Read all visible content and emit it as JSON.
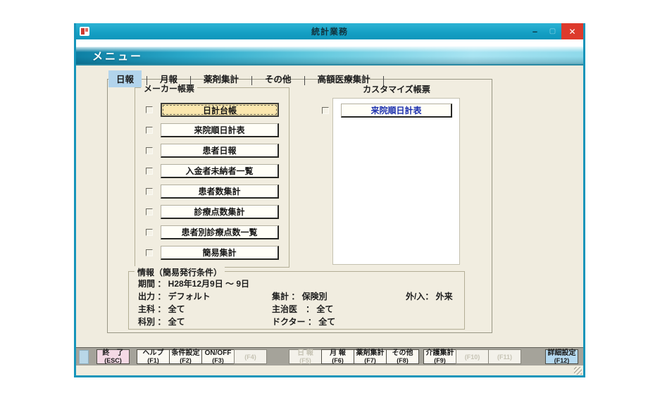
{
  "window": {
    "title": "統計業務",
    "controls": {
      "minimize": "–",
      "maximize": "▢",
      "close": "✕"
    }
  },
  "menu_header": "メニュー",
  "tabs": [
    {
      "label": "日報",
      "selected": true
    },
    {
      "label": "月報",
      "selected": false
    },
    {
      "label": "薬剤集計",
      "selected": false
    },
    {
      "label": "その他",
      "selected": false
    },
    {
      "label": "高額医療集計",
      "selected": false
    }
  ],
  "maker": {
    "title": "メーカー帳票",
    "items": [
      {
        "label": "日計台帳",
        "checked": false,
        "focused": true
      },
      {
        "label": "来院順日計表",
        "checked": false,
        "focused": false
      },
      {
        "label": "患者日報",
        "checked": false,
        "focused": false
      },
      {
        "label": "入金者未納者一覧",
        "checked": false,
        "focused": false
      },
      {
        "label": "患者数集計",
        "checked": false,
        "focused": false
      },
      {
        "label": "診療点数集計",
        "checked": false,
        "focused": false
      },
      {
        "label": "患者別診療点数一覧",
        "checked": false,
        "focused": false
      },
      {
        "label": "簡易集計",
        "checked": false,
        "focused": false
      }
    ]
  },
  "custom": {
    "title": "カスタマイズ帳票",
    "items": [
      {
        "label": "来院順日計表",
        "checked": false,
        "text_color": "#1b2fae"
      }
    ]
  },
  "info": {
    "title": "情報（簡易発行条件）",
    "period": {
      "label": "期間 ： ",
      "value": "H28年12月9日 ～ 9日"
    },
    "output": {
      "label": "出力 ： ",
      "value": "デフォルト"
    },
    "aggregate": {
      "label": "集計 ： ",
      "value": "保険別"
    },
    "inout": {
      "label": "外/入： ",
      "value": "外来"
    },
    "main_dept": {
      "label": "主科 ： ",
      "value": "全て"
    },
    "main_doctor": {
      "label": "主治医　： ",
      "value": "全て"
    },
    "category": {
      "label": "科別 ： ",
      "value": "全て"
    },
    "doctor": {
      "label": "ドクター ： ",
      "value": "全て"
    }
  },
  "fnbar": {
    "buttons": [
      {
        "label": "終　了",
        "key": "(ESC)",
        "style": "pink",
        "disabled": false
      },
      {
        "label": "ヘルプ",
        "key": "(F1)",
        "style": "",
        "disabled": false
      },
      {
        "label": "条件設定",
        "key": "(F2)",
        "style": "",
        "disabled": false
      },
      {
        "label": "ON/OFF",
        "key": "(F3)",
        "style": "",
        "disabled": false
      },
      {
        "label": "",
        "key": "(F4)",
        "style": "",
        "disabled": true
      },
      {
        "label": "日 報",
        "key": "(F5)",
        "style": "",
        "disabled": true
      },
      {
        "label": "月 報",
        "key": "(F6)",
        "style": "",
        "disabled": false
      },
      {
        "label": "薬剤集計",
        "key": "(F7)",
        "style": "",
        "disabled": false
      },
      {
        "label": "その他",
        "key": "(F8)",
        "style": "",
        "disabled": false
      },
      {
        "label": "介護集計",
        "key": "(F9)",
        "style": "",
        "disabled": false
      },
      {
        "label": "",
        "key": "(F10)",
        "style": "",
        "disabled": true
      },
      {
        "label": "",
        "key": "(F11)",
        "style": "",
        "disabled": true
      },
      {
        "label": "詳細設定",
        "key": "(F12)",
        "style": "blue",
        "disabled": false
      }
    ]
  },
  "colors": {
    "titlebar_teal": "#149fc4",
    "close_red": "#dd3a2c",
    "selected_tab_blue": "#b2d4ec",
    "focused_button_cream": "#fbe7ae",
    "custom_button_text_blue": "#1b2fae",
    "fn_pink": "#f4d9e5",
    "fn_blue": "#b5d9f0",
    "background_beige": "#f0ecdf"
  }
}
